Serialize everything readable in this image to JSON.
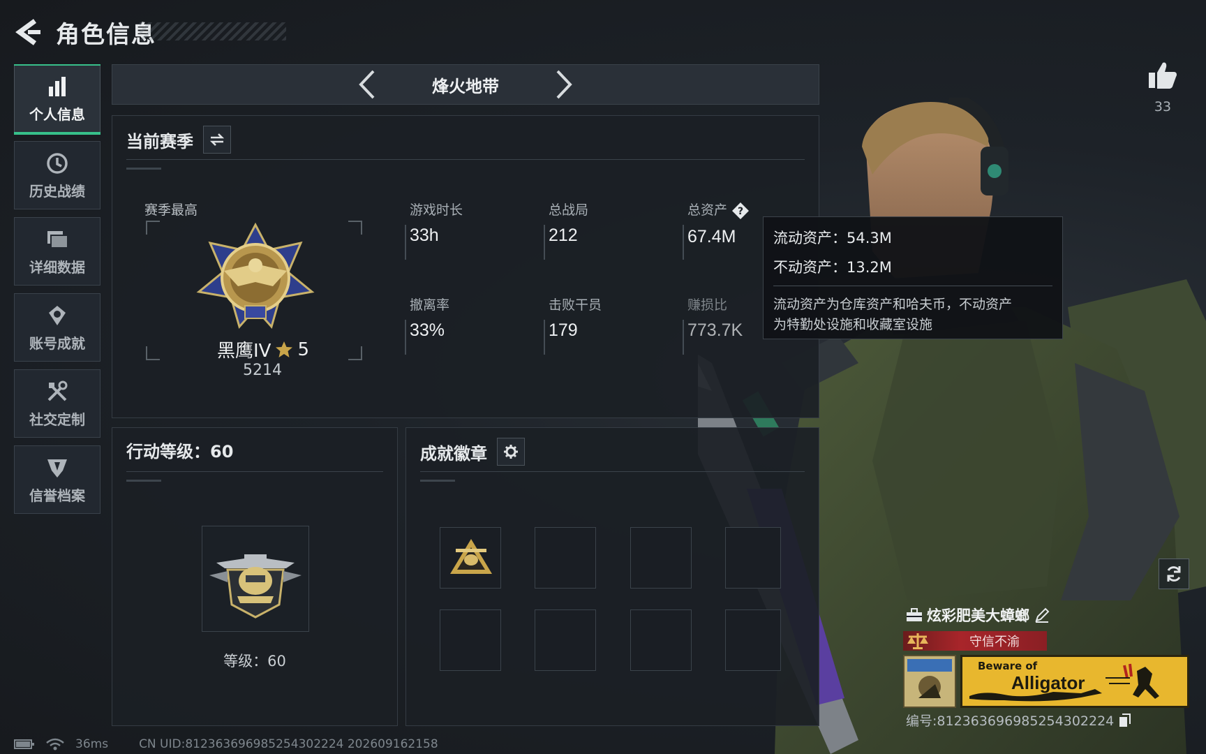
{
  "header": {
    "title": "角色信息"
  },
  "sidebar": {
    "items": [
      {
        "label": "个人信息",
        "icon": "bar-chart-icon",
        "active": true
      },
      {
        "label": "历史战绩",
        "icon": "history-icon"
      },
      {
        "label": "详细数据",
        "icon": "folders-icon"
      },
      {
        "label": "账号成就",
        "icon": "achievement-icon"
      },
      {
        "label": "社交定制",
        "icon": "tools-icon"
      },
      {
        "label": "信誉档案",
        "icon": "credit-shield-icon"
      }
    ]
  },
  "mode": {
    "title": "烽火地带"
  },
  "season": {
    "title": "当前赛季",
    "best_label": "赛季最高",
    "rank_name": "黑鹰IV",
    "rank_stars": "5",
    "rank_score": "5214",
    "stats": {
      "play_time": {
        "label": "游戏时长",
        "value": "33h"
      },
      "total_matches": {
        "label": "总战局",
        "value": "212"
      },
      "total_assets": {
        "label": "总资产",
        "value": "67.4M"
      },
      "extract_rate": {
        "label": "撤离率",
        "value": "33%"
      },
      "kills": {
        "label": "击败干员",
        "value": "179"
      },
      "profit_ratio": {
        "label": "赚损比",
        "value": "773.7K"
      }
    }
  },
  "tooltip": {
    "liquid": "流动资产：54.3M",
    "fixed": "不动资产：13.2M",
    "note_line1": "流动资产为仓库资产和哈夫币，不动资产",
    "note_line2": "为特勤处设施和收藏室设施"
  },
  "level": {
    "title": "行动等级：60",
    "label": "等级：60"
  },
  "achievements": {
    "title": "成就徽章"
  },
  "profile": {
    "likes": "33",
    "player_name": "炫彩肥美大蟑螂",
    "credit": "守信不渝",
    "banner_small": "Beware of",
    "banner_big": "Alligator",
    "uid": "编号:812363696985254302224"
  },
  "footer": {
    "ping": "36ms",
    "uid": "CN UID:812363696985254302224  202609162158"
  },
  "colors": {
    "accent": "#37c08a",
    "credit_red": "#a8252a",
    "banner_yellow": "#e8b72e"
  }
}
